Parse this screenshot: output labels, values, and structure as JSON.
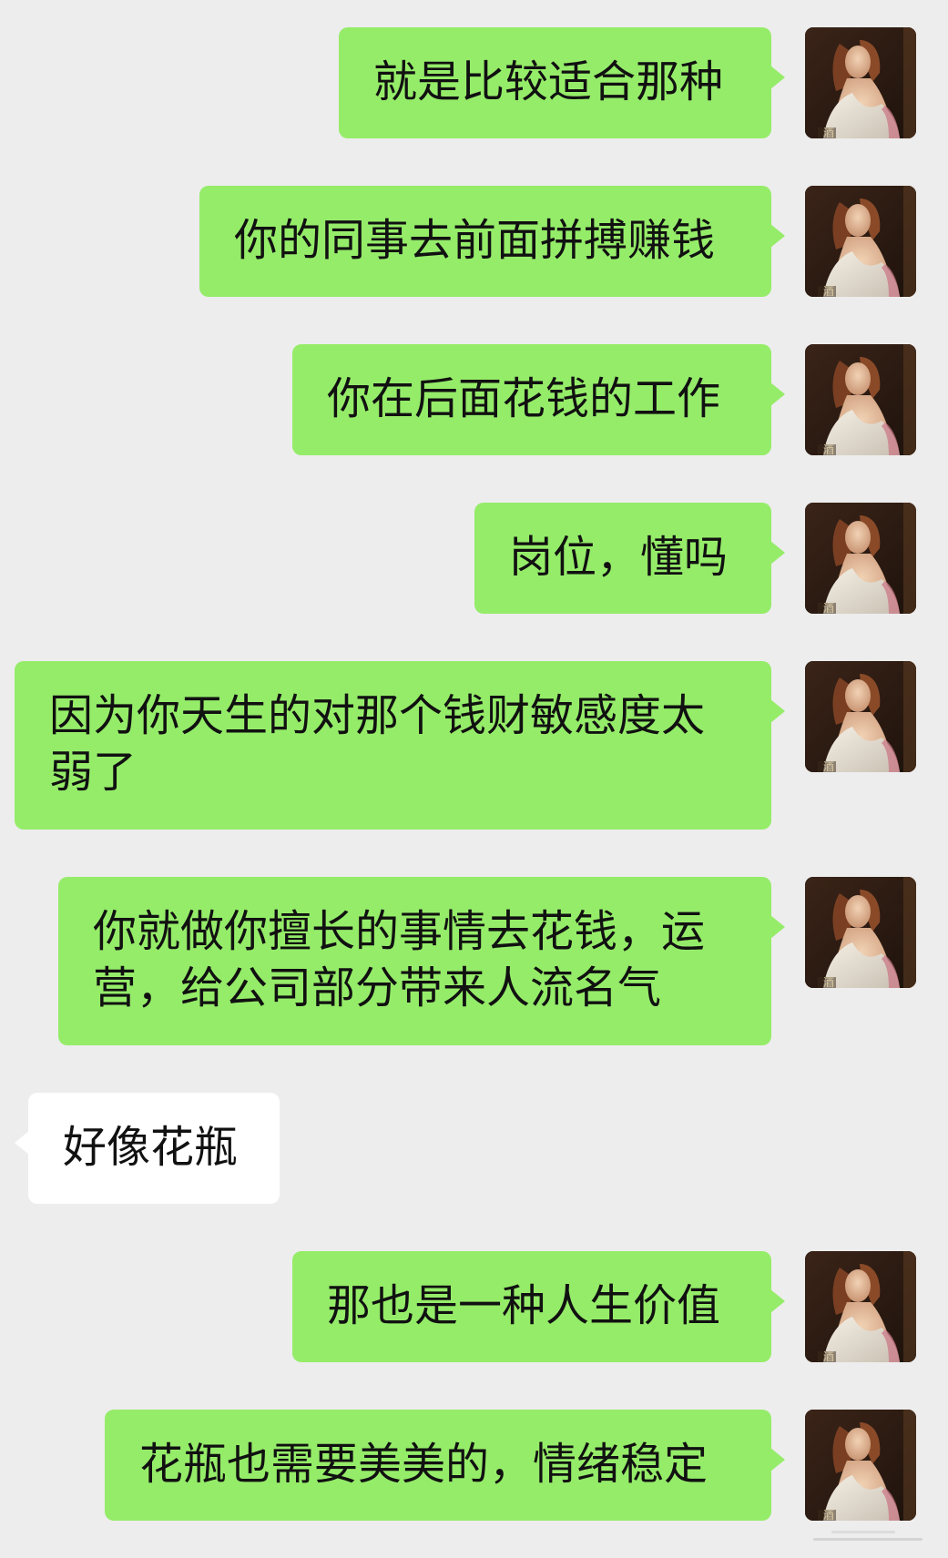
{
  "messages": [
    {
      "side": "out",
      "text": "就是比较适合那种"
    },
    {
      "side": "out",
      "text": "你的同事去前面拼搏赚钱"
    },
    {
      "side": "out",
      "text": "你在后面花钱的工作"
    },
    {
      "side": "out",
      "text": "岗位，懂吗"
    },
    {
      "side": "out",
      "text": "因为你天生的对那个钱财敏感度太弱了"
    },
    {
      "side": "out",
      "text": "你就做你擅长的事情去花钱，运营，给公司部分带来人流名气"
    },
    {
      "side": "in",
      "text": "好像花瓶"
    },
    {
      "side": "out",
      "text": "那也是一种人生价值"
    },
    {
      "side": "out",
      "text": "花瓶也需要美美的，情绪稳定"
    }
  ],
  "colors": {
    "background": "#ededed",
    "outgoing_bubble": "#95ec69",
    "incoming_bubble": "#ffffff"
  },
  "avatar": {
    "icon": "renaissance-portrait-avatar"
  }
}
